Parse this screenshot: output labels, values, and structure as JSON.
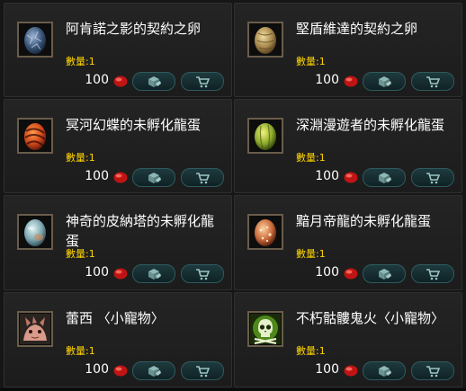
{
  "items": [
    {
      "name": "阿肯諾之影的契約之卵",
      "qty": "數量:1",
      "price": "100",
      "icon": "egg-blue-dark-icon"
    },
    {
      "name": "堅盾維達的契約之卵",
      "qty": "數量:1",
      "price": "100",
      "icon": "egg-golden-icon"
    },
    {
      "name": "冥河幻蝶的未孵化龍蛋",
      "qty": "數量:1",
      "price": "100",
      "icon": "egg-orange-swirl-icon"
    },
    {
      "name": "深淵漫遊者的未孵化龍蛋",
      "qty": "數量:1",
      "price": "100",
      "icon": "egg-green-icon"
    },
    {
      "name": "神奇的皮納塔的未孵化龍蛋",
      "qty": "數量:1",
      "price": "100",
      "icon": "egg-pale-blue-icon"
    },
    {
      "name": "黯月帝龍的未孵化龍蛋",
      "qty": "數量:1",
      "price": "100",
      "icon": "egg-speckled-orange-icon"
    },
    {
      "name": "蕾西 〈小寵物〉",
      "qty": "數量:1",
      "price": "100",
      "icon": "pink-creature-icon"
    },
    {
      "name": "不朽骷髏鬼火〈小寵物〉",
      "qty": "數量:1",
      "price": "100",
      "icon": "green-skull-icon"
    }
  ],
  "currency_icon": "red-gem-icon",
  "gift_button_icon": "gift-icon",
  "cart_button_icon": "cart-icon",
  "colors": {
    "quantity_text": "#ffd400",
    "button_teal": "#1e3a3e",
    "gem_red": "#d01818",
    "icon_frame": "#6a5c4a"
  }
}
